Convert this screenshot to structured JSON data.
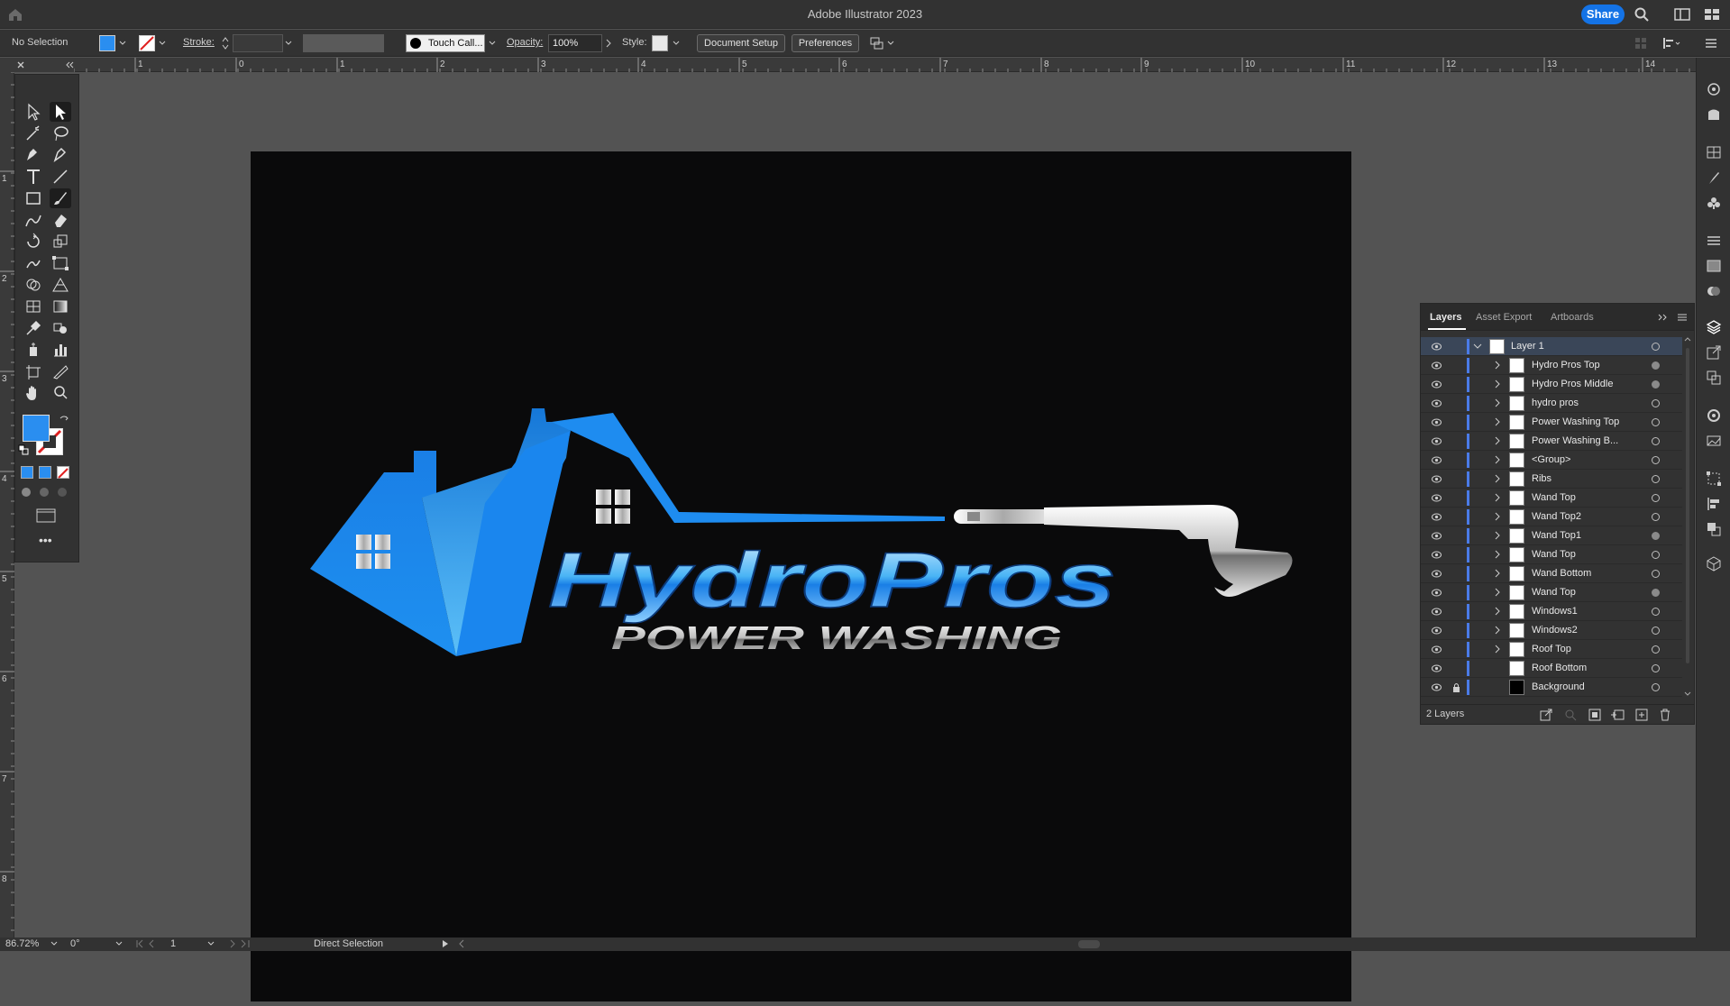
{
  "app": {
    "title": "Adobe Illustrator 2023",
    "share_label": "Share"
  },
  "control_bar": {
    "selection_state": "No Selection",
    "stroke_label": "Stroke:",
    "brush_name": "Touch Call...",
    "opacity_label": "Opacity:",
    "opacity_value": "100%",
    "style_label": "Style:",
    "document_setup": "Document Setup",
    "preferences": "Preferences",
    "fill_color": "#2a8ef0"
  },
  "rulers": {
    "horizontal_ticks": [
      "2",
      "1",
      "0",
      "1",
      "2",
      "3",
      "4",
      "5",
      "6",
      "7",
      "8",
      "9",
      "10",
      "11",
      "12",
      "13",
      "14"
    ],
    "vertical_ticks": [
      "1",
      "2",
      "3",
      "4",
      "5",
      "6",
      "7",
      "8"
    ]
  },
  "logo": {
    "word_main": "HydroPros",
    "word_sub": "POWER WASHING",
    "accent": "#1e90f0",
    "accent_light": "#8fd0ff"
  },
  "layers_panel": {
    "tabs": [
      "Layers",
      "Asset Export",
      "Artboards"
    ],
    "active_tab": "Layers",
    "count_label": "2 Layers",
    "rows": [
      {
        "name": "Layer 1",
        "level": 0,
        "expanded": true,
        "selected": true,
        "target_filled": false,
        "locked": false
      },
      {
        "name": "Hydro Pros Top",
        "level": 1,
        "target_filled": true
      },
      {
        "name": "Hydro Pros Middle",
        "level": 1,
        "target_filled": true
      },
      {
        "name": "hydro pros",
        "level": 1,
        "target_filled": false
      },
      {
        "name": "Power Washing Top",
        "level": 1,
        "target_filled": false
      },
      {
        "name": "Power Washing B...",
        "level": 1,
        "target_filled": false
      },
      {
        "name": "<Group>",
        "level": 1,
        "target_filled": false
      },
      {
        "name": "Ribs",
        "level": 1,
        "target_filled": false
      },
      {
        "name": "Wand Top",
        "level": 1,
        "target_filled": false
      },
      {
        "name": "Wand Top2",
        "level": 1,
        "target_filled": false
      },
      {
        "name": "Wand Top1",
        "level": 1,
        "target_filled": true
      },
      {
        "name": "Wand Top",
        "level": 1,
        "target_filled": false
      },
      {
        "name": "Wand Bottom",
        "level": 1,
        "target_filled": false
      },
      {
        "name": "Wand Top",
        "level": 1,
        "target_filled": true
      },
      {
        "name": "Windows1",
        "level": 1,
        "target_filled": false
      },
      {
        "name": "Windows2",
        "level": 1,
        "target_filled": false
      },
      {
        "name": "Roof Top",
        "level": 1,
        "target_filled": false
      },
      {
        "name": "Roof Bottom",
        "level": 1,
        "target_filled": false,
        "no_chevron": true
      },
      {
        "name": "Background",
        "level": 1,
        "target_filled": false,
        "no_chevron": true,
        "locked": true,
        "black_thumb": true
      }
    ]
  },
  "status_bar": {
    "zoom": "86.72%",
    "rotation": "0°",
    "artboard_number": "1",
    "tool_name": "Direct Selection"
  }
}
